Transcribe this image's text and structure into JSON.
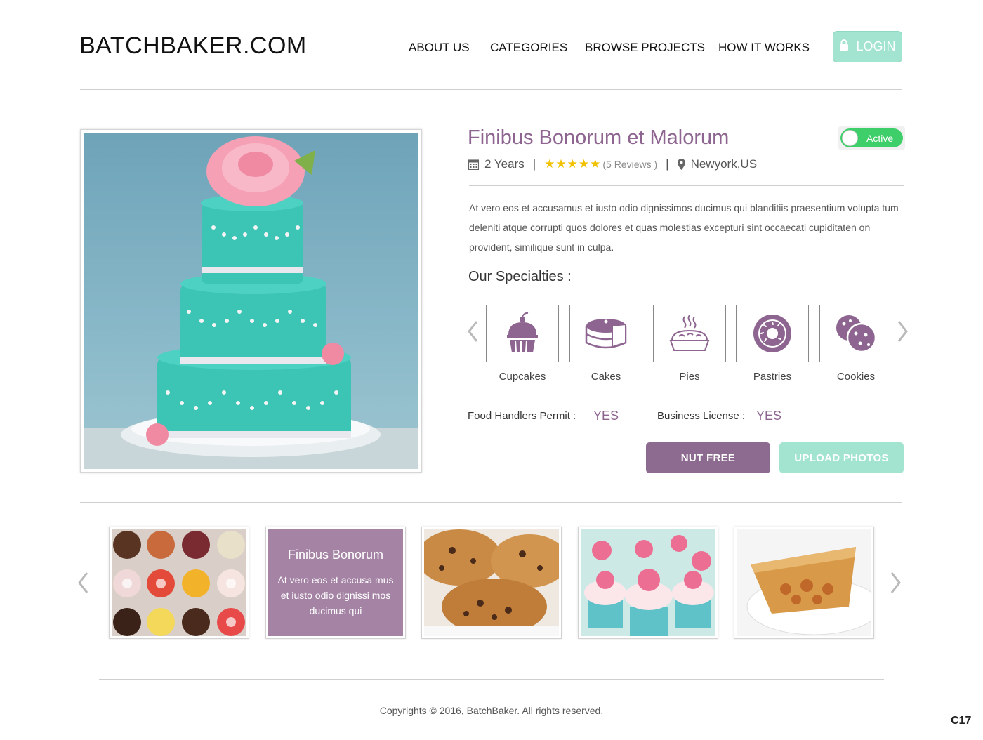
{
  "header": {
    "logo": "BATCHBAKER.COM",
    "nav": [
      "ABOUT US",
      "CATEGORIES",
      "BROWSE PROJECTS",
      "HOW IT WORKS"
    ],
    "login_label": "LOGIN"
  },
  "profile": {
    "title": "Finibus Bonorum et Malorum",
    "status": "Active",
    "experience": "2 Years",
    "rating_stars": "★★★★★",
    "rating": 5,
    "reviews": "(5 Reviews )",
    "location": "Newyork,US",
    "description": "At vero eos et accusamus et iusto odio dignissimos ducimus qui blanditiis praesentium volupta tum deleniti atque corrupti quos dolores et quas molestias excepturi sint occaecati cupiditaten on provident, similique sunt in culpa."
  },
  "specialties": {
    "heading": "Our Specialties :",
    "items": [
      {
        "label": "Cupcakes",
        "icon": "cupcake-icon"
      },
      {
        "label": "Cakes",
        "icon": "cake-icon"
      },
      {
        "label": "Pies",
        "icon": "pie-icon"
      },
      {
        "label": "Pastries",
        "icon": "donut-icon"
      },
      {
        "label": "Cookies",
        "icon": "cookie-icon"
      }
    ]
  },
  "permits": {
    "food_label": "Food Handlers Permit :",
    "food_value": "YES",
    "business_label": "Business License :",
    "business_value": "YES"
  },
  "actions": {
    "nut_free": "NUT FREE",
    "upload": "UPLOAD PHOTOS"
  },
  "gallery": {
    "overlay_title": "Finibus Bonorum",
    "overlay_text": "At vero eos et accusa mus et iusto odio dignissi mos ducimus qui"
  },
  "footer": {
    "copyright": "Copyrights © 2016, BatchBaker. All rights reserved.",
    "code": "C17"
  },
  "colors": {
    "accent_purple": "#8d6590",
    "accent_mint": "#a3e4d1",
    "toggle_green": "#3fcf6a",
    "star_yellow": "#f2c200"
  }
}
